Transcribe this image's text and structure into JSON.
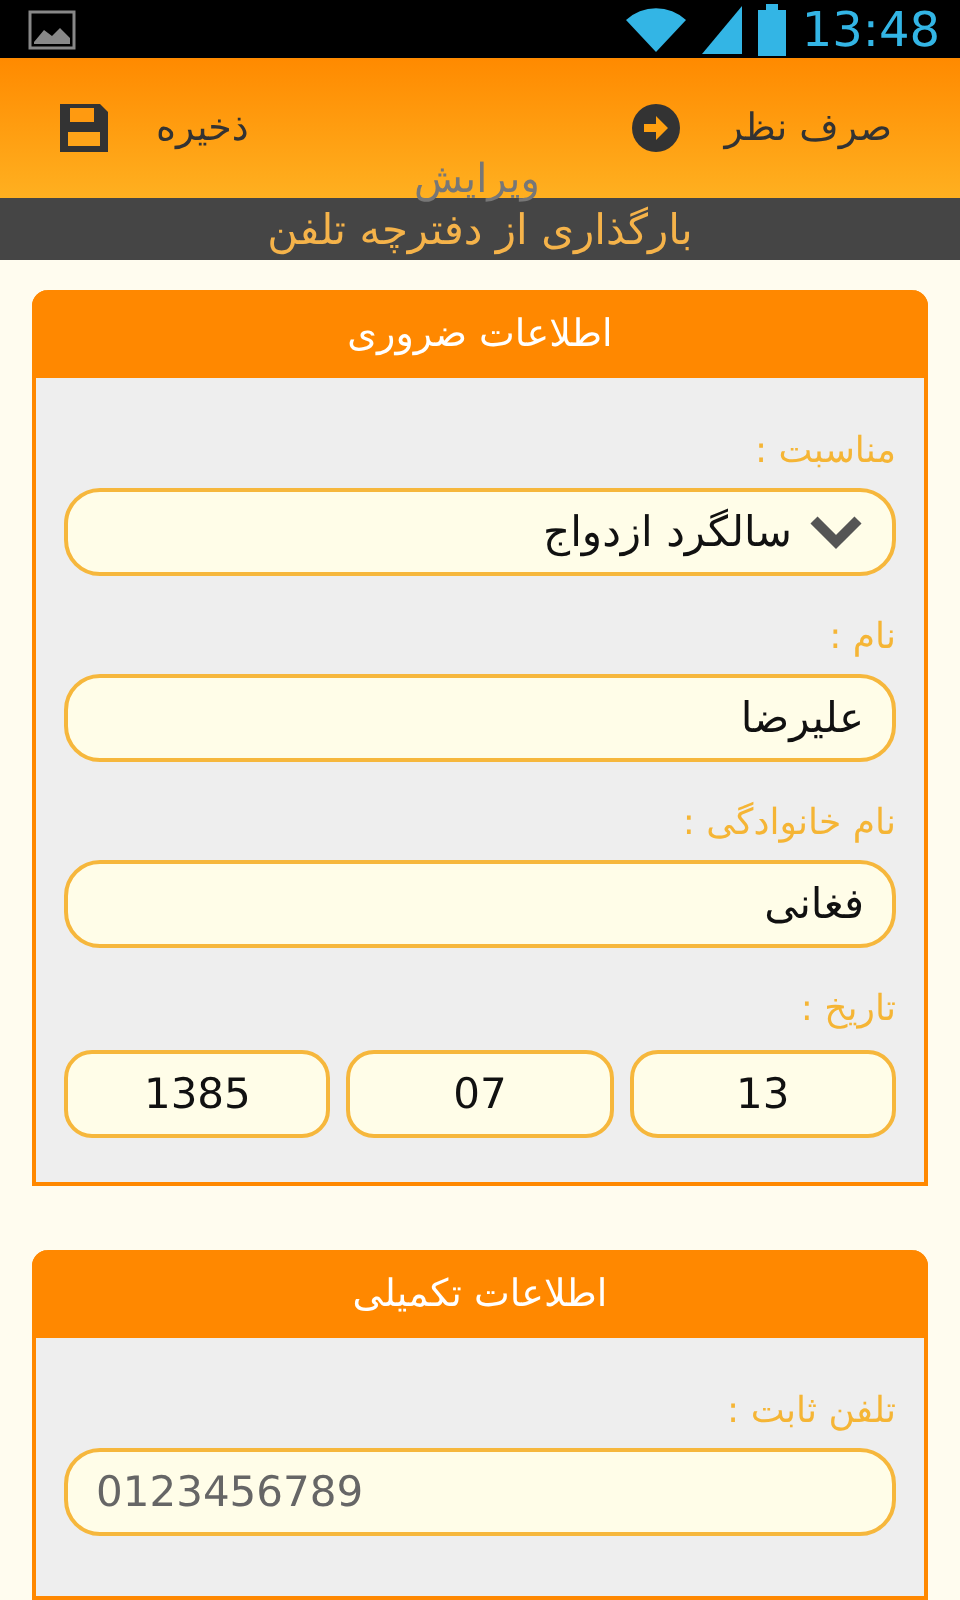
{
  "status_bar": {
    "time": "13:48"
  },
  "action_bar": {
    "cancel": "صرف نظر",
    "save": "ذخیره",
    "title": "ویرایش"
  },
  "import_bar": {
    "label": "بارگذاری از دفترچه تلفن"
  },
  "sections": [
    {
      "title": "اطلاعات ضروری",
      "fields": [
        {
          "kind": "dropdown",
          "label": "مناسبت :",
          "value": "سالگرد ازدواج"
        },
        {
          "kind": "text",
          "label": "نام :",
          "value": "علیرضا"
        },
        {
          "kind": "text",
          "label": "نام خانوادگی :",
          "value": "فغانی"
        },
        {
          "kind": "date",
          "label": "تاریخ :",
          "parts": [
            "13",
            "07",
            "1385"
          ]
        }
      ]
    },
    {
      "title": "اطلاعات تکمیلی",
      "fields": [
        {
          "kind": "phone",
          "label": "تلفن ثابت :",
          "value": "0123456789"
        }
      ]
    }
  ]
}
